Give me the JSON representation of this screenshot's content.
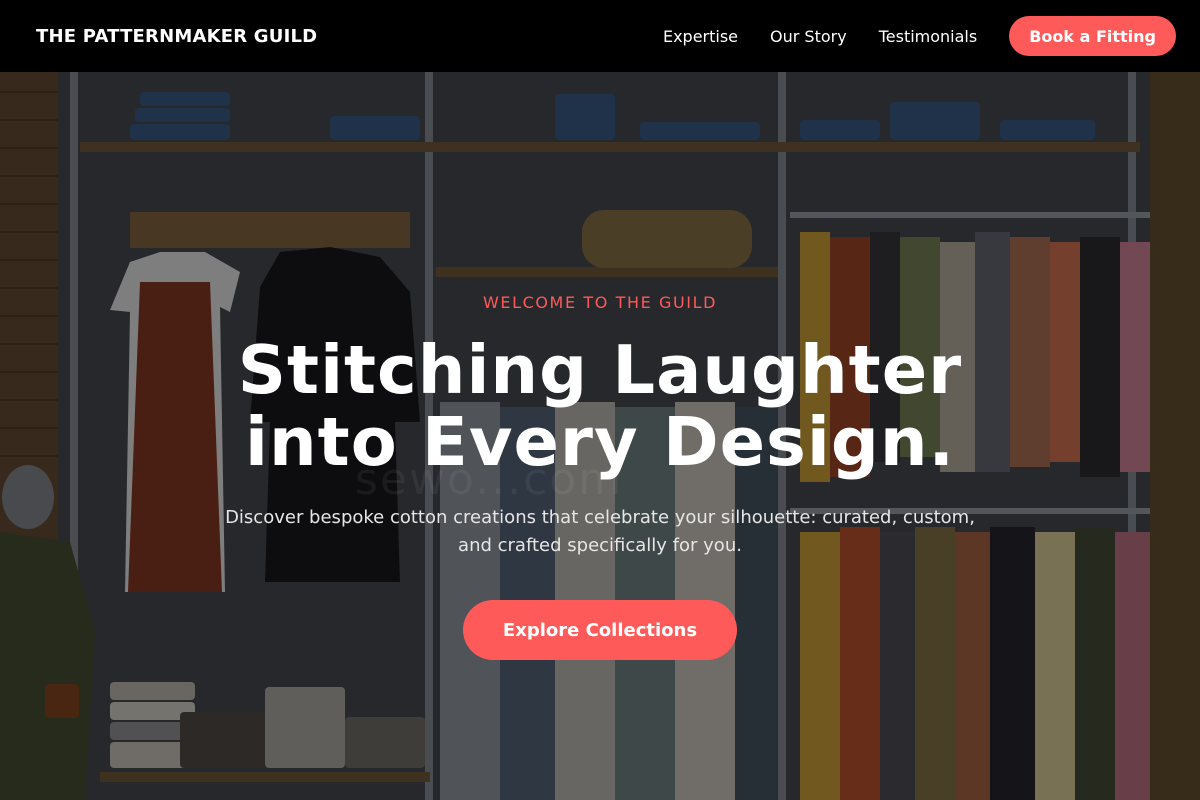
{
  "header": {
    "brand": "THE PATTERNMAKER GUILD",
    "nav": [
      "Expertise",
      "Our Story",
      "Testimonials"
    ],
    "cta_label": "Book a Fitting"
  },
  "hero": {
    "eyebrow": "WELCOME TO THE GUILD",
    "headline_line1": "Stitching Laughter",
    "headline_line2": "into Every Design.",
    "subhead_line1": "Discover bespoke cotton creations that celebrate your silhouette: curated, custom,",
    "subhead_line2": "and crafted specifically for you.",
    "cta_label": "Explore Collections",
    "watermark": "sewo...com"
  },
  "colors": {
    "accent": "#ff5a5a",
    "header_bg": "#000000"
  }
}
